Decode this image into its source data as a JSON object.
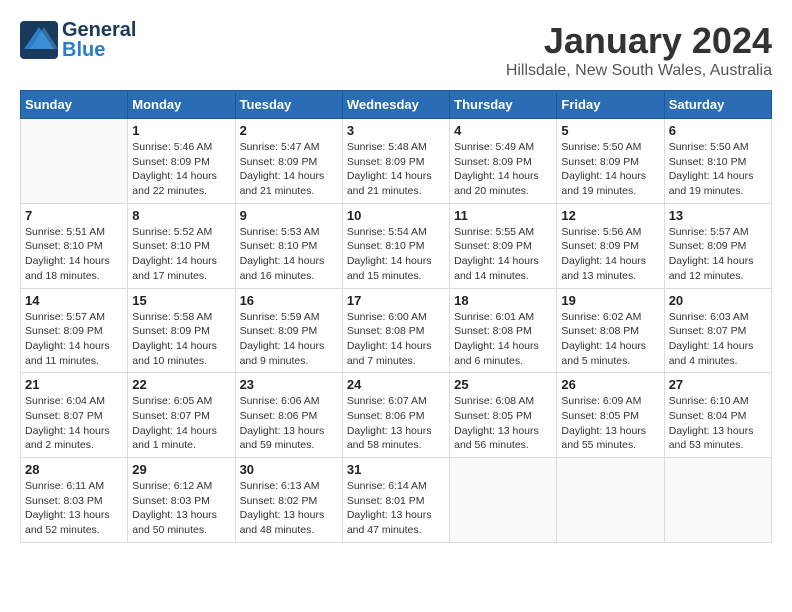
{
  "header": {
    "logo_general": "General",
    "logo_blue": "Blue",
    "month_title": "January 2024",
    "location": "Hillsdale, New South Wales, Australia"
  },
  "days_of_week": [
    "Sunday",
    "Monday",
    "Tuesday",
    "Wednesday",
    "Thursday",
    "Friday",
    "Saturday"
  ],
  "weeks": [
    [
      {
        "day": "",
        "info": ""
      },
      {
        "day": "1",
        "info": "Sunrise: 5:46 AM\nSunset: 8:09 PM\nDaylight: 14 hours\nand 22 minutes."
      },
      {
        "day": "2",
        "info": "Sunrise: 5:47 AM\nSunset: 8:09 PM\nDaylight: 14 hours\nand 21 minutes."
      },
      {
        "day": "3",
        "info": "Sunrise: 5:48 AM\nSunset: 8:09 PM\nDaylight: 14 hours\nand 21 minutes."
      },
      {
        "day": "4",
        "info": "Sunrise: 5:49 AM\nSunset: 8:09 PM\nDaylight: 14 hours\nand 20 minutes."
      },
      {
        "day": "5",
        "info": "Sunrise: 5:50 AM\nSunset: 8:09 PM\nDaylight: 14 hours\nand 19 minutes."
      },
      {
        "day": "6",
        "info": "Sunrise: 5:50 AM\nSunset: 8:10 PM\nDaylight: 14 hours\nand 19 minutes."
      }
    ],
    [
      {
        "day": "7",
        "info": "Sunrise: 5:51 AM\nSunset: 8:10 PM\nDaylight: 14 hours\nand 18 minutes."
      },
      {
        "day": "8",
        "info": "Sunrise: 5:52 AM\nSunset: 8:10 PM\nDaylight: 14 hours\nand 17 minutes."
      },
      {
        "day": "9",
        "info": "Sunrise: 5:53 AM\nSunset: 8:10 PM\nDaylight: 14 hours\nand 16 minutes."
      },
      {
        "day": "10",
        "info": "Sunrise: 5:54 AM\nSunset: 8:10 PM\nDaylight: 14 hours\nand 15 minutes."
      },
      {
        "day": "11",
        "info": "Sunrise: 5:55 AM\nSunset: 8:09 PM\nDaylight: 14 hours\nand 14 minutes."
      },
      {
        "day": "12",
        "info": "Sunrise: 5:56 AM\nSunset: 8:09 PM\nDaylight: 14 hours\nand 13 minutes."
      },
      {
        "day": "13",
        "info": "Sunrise: 5:57 AM\nSunset: 8:09 PM\nDaylight: 14 hours\nand 12 minutes."
      }
    ],
    [
      {
        "day": "14",
        "info": "Sunrise: 5:57 AM\nSunset: 8:09 PM\nDaylight: 14 hours\nand 11 minutes."
      },
      {
        "day": "15",
        "info": "Sunrise: 5:58 AM\nSunset: 8:09 PM\nDaylight: 14 hours\nand 10 minutes."
      },
      {
        "day": "16",
        "info": "Sunrise: 5:59 AM\nSunset: 8:09 PM\nDaylight: 14 hours\nand 9 minutes."
      },
      {
        "day": "17",
        "info": "Sunrise: 6:00 AM\nSunset: 8:08 PM\nDaylight: 14 hours\nand 7 minutes."
      },
      {
        "day": "18",
        "info": "Sunrise: 6:01 AM\nSunset: 8:08 PM\nDaylight: 14 hours\nand 6 minutes."
      },
      {
        "day": "19",
        "info": "Sunrise: 6:02 AM\nSunset: 8:08 PM\nDaylight: 14 hours\nand 5 minutes."
      },
      {
        "day": "20",
        "info": "Sunrise: 6:03 AM\nSunset: 8:07 PM\nDaylight: 14 hours\nand 4 minutes."
      }
    ],
    [
      {
        "day": "21",
        "info": "Sunrise: 6:04 AM\nSunset: 8:07 PM\nDaylight: 14 hours\nand 2 minutes."
      },
      {
        "day": "22",
        "info": "Sunrise: 6:05 AM\nSunset: 8:07 PM\nDaylight: 14 hours\nand 1 minute."
      },
      {
        "day": "23",
        "info": "Sunrise: 6:06 AM\nSunset: 8:06 PM\nDaylight: 13 hours\nand 59 minutes."
      },
      {
        "day": "24",
        "info": "Sunrise: 6:07 AM\nSunset: 8:06 PM\nDaylight: 13 hours\nand 58 minutes."
      },
      {
        "day": "25",
        "info": "Sunrise: 6:08 AM\nSunset: 8:05 PM\nDaylight: 13 hours\nand 56 minutes."
      },
      {
        "day": "26",
        "info": "Sunrise: 6:09 AM\nSunset: 8:05 PM\nDaylight: 13 hours\nand 55 minutes."
      },
      {
        "day": "27",
        "info": "Sunrise: 6:10 AM\nSunset: 8:04 PM\nDaylight: 13 hours\nand 53 minutes."
      }
    ],
    [
      {
        "day": "28",
        "info": "Sunrise: 6:11 AM\nSunset: 8:03 PM\nDaylight: 13 hours\nand 52 minutes."
      },
      {
        "day": "29",
        "info": "Sunrise: 6:12 AM\nSunset: 8:03 PM\nDaylight: 13 hours\nand 50 minutes."
      },
      {
        "day": "30",
        "info": "Sunrise: 6:13 AM\nSunset: 8:02 PM\nDaylight: 13 hours\nand 48 minutes."
      },
      {
        "day": "31",
        "info": "Sunrise: 6:14 AM\nSunset: 8:01 PM\nDaylight: 13 hours\nand 47 minutes."
      },
      {
        "day": "",
        "info": ""
      },
      {
        "day": "",
        "info": ""
      },
      {
        "day": "",
        "info": ""
      }
    ]
  ]
}
